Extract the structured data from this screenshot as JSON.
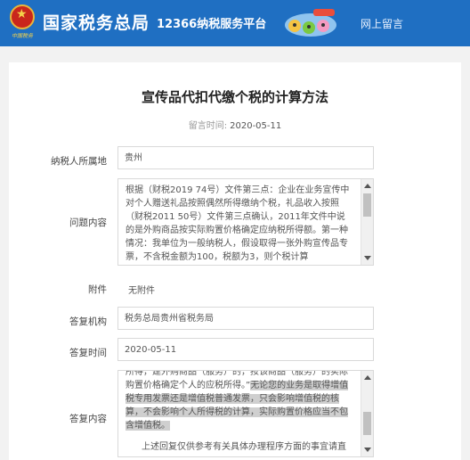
{
  "header": {
    "emblem_text": "中国税务",
    "brand": "国家税务总局",
    "platform": "12366纳税服务平台",
    "nav_link": "网上留言",
    "color": "#1f6fc2"
  },
  "article": {
    "title": "宣传品代扣代缴个税的计算方法",
    "meta_label": "留言时间:",
    "meta_date": "2020-05-11"
  },
  "form": {
    "location_label": "纳税人所属地",
    "location_value": "贵州",
    "question_label": "问题内容",
    "question_text": "根据（财税2019 74号）文件第三点：企业在业务宣传中对个人赠送礼品按照偶然所得缴纳个税，礼品收入按照（财税2011 50号）文件第三点确认，2011年文件中说的是外购商品按实际购置价格确定应纳税所得额。第一种情况：我单位为一般纳税人，假设取得一张外购宣传品专票，不含税金额为100，税额为3，则个税计算",
    "question_scroll_level": 0.1,
    "attachment_label": "附件",
    "attachment_value": "无附件",
    "agency_label": "答复机构",
    "agency_value": "税务总局贵州省税务局",
    "reply_time_label": "答复时间",
    "reply_time_value": "2020-05-11",
    "reply_label": "答复内容",
    "reply_text_1": "所得，建外购商品（服务）的，按该商品（服务）的实际购置价格确定个人的应税所得。”",
    "reply_text_highlight": "无论您的业务是取得增值税专用发票还是增值税普通发票，只会影响增值税的核算，不会影响个人所得税的计算，实际购置价格应当不包含增值税。",
    "reply_text_2": "上述回复仅供参考有关具体办理程序方面的事宜请直",
    "reply_scroll_level": 0.7
  }
}
